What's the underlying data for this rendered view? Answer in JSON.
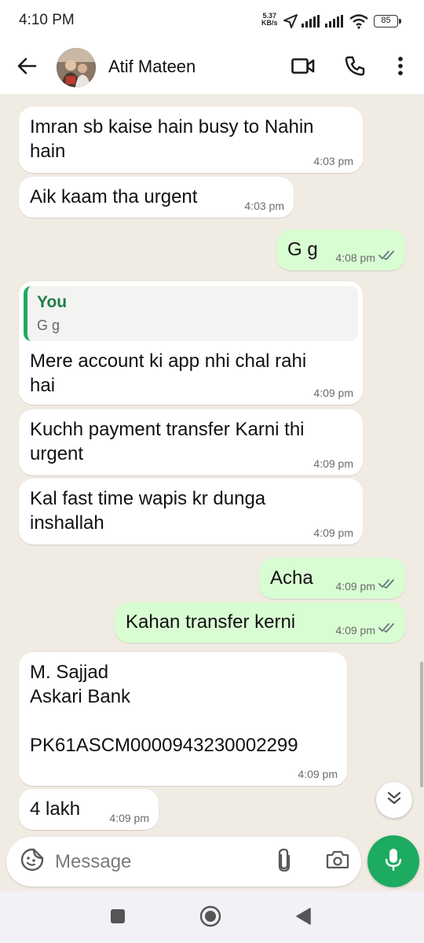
{
  "status_bar": {
    "time": "4:10 PM",
    "net_speed_value": "5.37",
    "net_speed_unit": "KB/s",
    "battery": "85",
    "icons": [
      "location-arrow-icon",
      "signal-icon",
      "signal-icon",
      "wifi-icon",
      "battery-icon"
    ]
  },
  "header": {
    "contact_name": "Atif Mateen",
    "icons": [
      "back-arrow-icon",
      "video-call-icon",
      "voice-call-icon",
      "more-options-icon"
    ]
  },
  "messages": [
    {
      "direction": "in",
      "text": "Imran sb kaise hain busy to Nahin\nhain",
      "time": "4:03 pm"
    },
    {
      "direction": "in",
      "text": "Aik kaam tha urgent",
      "time": "4:03 pm"
    },
    {
      "direction": "out",
      "text": "G g",
      "time": "4:08 pm",
      "status": "read"
    },
    {
      "direction": "in",
      "quote_author": "You",
      "quote_text": "G g",
      "text": "Mere account ki app nhi chal rahi\nhai",
      "time": "4:09 pm"
    },
    {
      "direction": "in",
      "text": "Kuchh payment transfer Karni thi\nurgent",
      "time": "4:09 pm"
    },
    {
      "direction": "in",
      "text": "Kal fast time wapis kr dunga\ninshallah",
      "time": "4:09 pm"
    },
    {
      "direction": "out",
      "text": "Acha",
      "time": "4:09 pm",
      "status": "read"
    },
    {
      "direction": "out",
      "text": "Kahan transfer kerni",
      "time": "4:09 pm",
      "status": "read"
    },
    {
      "direction": "in",
      "text": "M. Sajjad\nAskari Bank\n\nPK61ASCM0000943230002299",
      "time": "4:09 pm"
    },
    {
      "direction": "in",
      "text": "4 lakh",
      "time": "4:09 pm"
    }
  ],
  "composer": {
    "placeholder": "Message",
    "icons": [
      "emoji-sticker-icon",
      "paperclip-icon",
      "camera-icon",
      "microphone-icon"
    ]
  },
  "colors": {
    "incoming_bubble": "#ffffff",
    "outgoing_bubble": "#d9fdd3",
    "chat_background": "#f0ebe3",
    "accent_green": "#1daa61",
    "read_tick": "#667781"
  }
}
